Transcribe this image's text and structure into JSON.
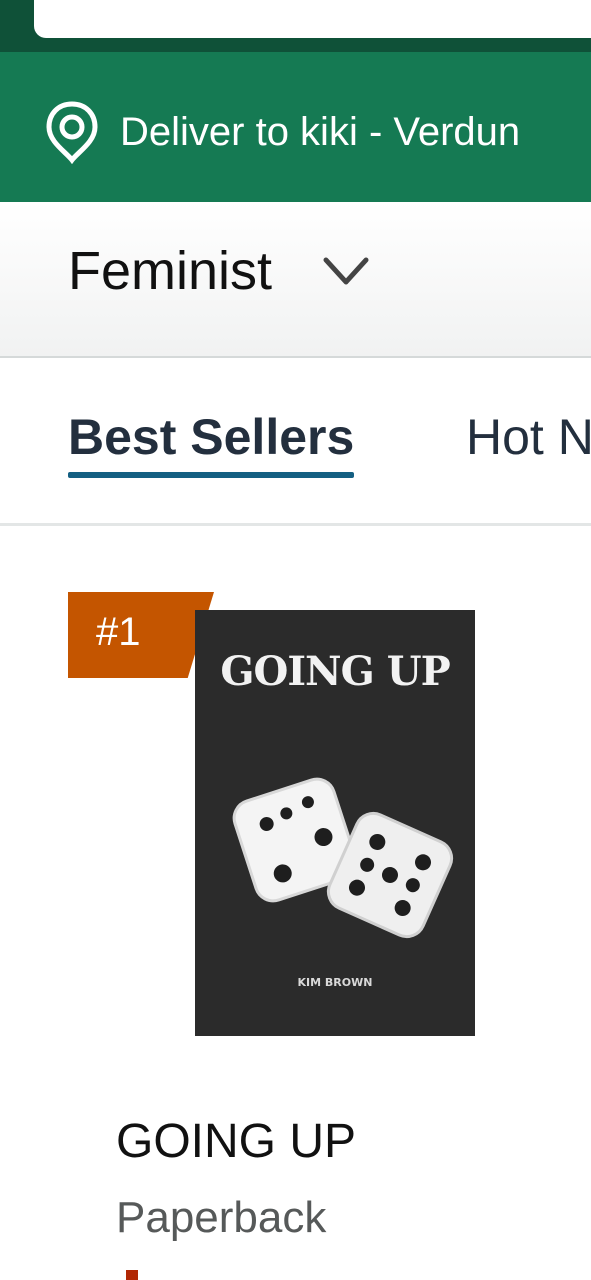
{
  "header": {
    "deliver_text": "Deliver to kiki - Verdun",
    "location_icon": "location-pin-icon"
  },
  "category": {
    "label": "Feminist",
    "dropdown_icon": "chevron-down-icon"
  },
  "tabs": [
    {
      "label": "Best Sellers",
      "active": true
    },
    {
      "label": "Hot N",
      "active": false
    }
  ],
  "product": {
    "rank": "#1",
    "cover_title": "GOING UP",
    "cover_author": "KIM BROWN",
    "title": "GOING UP",
    "format": "Paperback"
  },
  "colors": {
    "topbar": "#0f5138",
    "deliver_bar": "#157a53",
    "rank_badge": "#c45500",
    "active_tab_underline": "#145f82",
    "price": "#b12704"
  }
}
